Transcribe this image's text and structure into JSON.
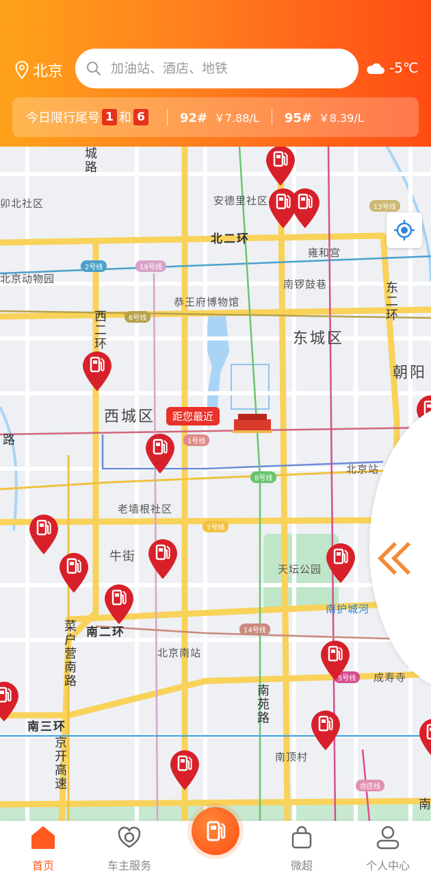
{
  "header": {
    "city": "北京",
    "search_placeholder": "加油站、酒店、地铁",
    "weather": "-5℃",
    "limit_label": "今日限行尾号",
    "limit_numbers": [
      "1",
      "6"
    ],
    "limit_and": "和",
    "prices": [
      {
        "grade": "92#",
        "value": "￥7.88/L"
      },
      {
        "grade": "95#",
        "value": "￥8.39/L"
      }
    ]
  },
  "map": {
    "nearest_tag": "距您最近",
    "districts": [
      "东城区",
      "西城区",
      "朝阳"
    ],
    "places": [
      "安德里社区",
      "雍和宫",
      "北京动物园",
      "恭王府博物馆",
      "南锣鼓巷",
      "老墙根社区",
      "牛街",
      "天坛公园",
      "南护城河",
      "北京站",
      "北京南站",
      "成寿寺",
      "南顶村",
      "卯北社区"
    ],
    "roads": [
      "北二环",
      "南二环",
      "南三环",
      "西二环",
      "东二环",
      "菜户营南路",
      "京开高速",
      "南苑路",
      "城路",
      "路",
      "南"
    ],
    "line_tags": [
      "2号线",
      "19号线",
      "6号线",
      "13号线",
      "1号线",
      "8号线",
      "7号线",
      "14号线",
      "5号线",
      "亦庄线"
    ],
    "pins_count": 18
  },
  "tabbar": {
    "items": [
      {
        "label": "首页",
        "icon": "home-icon",
        "active": true
      },
      {
        "label": "车主服务",
        "icon": "car-owner-icon",
        "active": false
      },
      {
        "label": "微超",
        "icon": "shopping-bag-icon",
        "active": false
      },
      {
        "label": "个人中心",
        "icon": "profile-icon",
        "active": false
      }
    ],
    "center_icon": "fuel-pump-icon"
  },
  "colors": {
    "brand_orange": "#ff7f1e",
    "brand_red": "#e3321c",
    "pin_red": "#d8202a",
    "active_tab": "#ff5a1f"
  }
}
